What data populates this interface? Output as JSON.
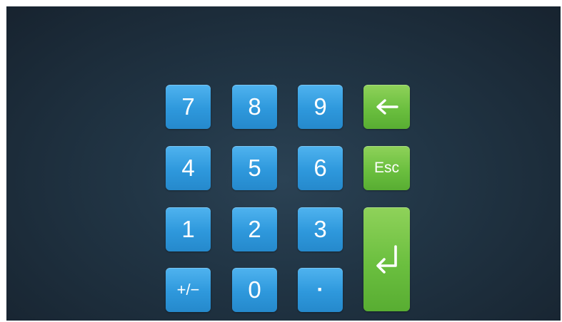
{
  "keypad": {
    "keys": {
      "k7": "7",
      "k8": "8",
      "k9": "9",
      "k4": "4",
      "k5": "5",
      "k6": "6",
      "k1": "1",
      "k2": "2",
      "k3": "3",
      "sign": "+/−",
      "k0": "0",
      "dot": "·",
      "esc": "Esc"
    },
    "icons": {
      "backspace": "left-arrow-icon",
      "enter": "enter-return-icon"
    },
    "colors": {
      "digit_key": "#2e98dc",
      "action_key": "#6bbf3f",
      "background": "#213545"
    }
  }
}
